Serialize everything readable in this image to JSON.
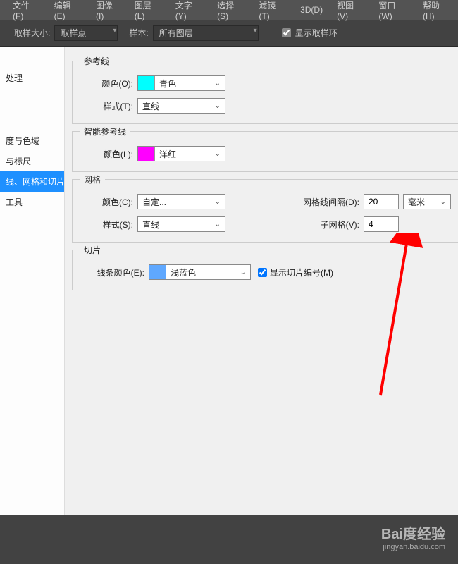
{
  "menubar": [
    {
      "label": "文件(F)"
    },
    {
      "label": "编辑(E)"
    },
    {
      "label": "图像(I)"
    },
    {
      "label": "图层(L)"
    },
    {
      "label": "文字(Y)"
    },
    {
      "label": "选择(S)"
    },
    {
      "label": "滤镜(T)"
    },
    {
      "label": "3D(D)"
    },
    {
      "label": "视图(V)"
    },
    {
      "label": "窗口(W)"
    },
    {
      "label": "帮助(H)"
    }
  ],
  "toolbar": {
    "sample_size_label": "取样大小:",
    "sample_size_value": "取样点",
    "sample_label": "样本:",
    "sample_value": "所有图层",
    "show_ring_label": "显示取样环",
    "show_ring_checked": true
  },
  "sidebar": {
    "items": [
      {
        "label": "处理",
        "selected": false
      },
      {
        "label": "度与色域",
        "selected": false
      },
      {
        "label": "与标尺",
        "selected": false
      },
      {
        "label": "线、网格和切片",
        "selected": true
      },
      {
        "label": "工具",
        "selected": false
      }
    ]
  },
  "guides": {
    "title": "参考线",
    "color_label": "颜色(O):",
    "color_value": "青色",
    "color_swatch": "#00ffff",
    "style_label": "样式(T):",
    "style_value": "直线"
  },
  "smart_guides": {
    "title": "智能参考线",
    "color_label": "颜色(L):",
    "color_value": "洋红",
    "color_swatch": "#ff00ff"
  },
  "grid": {
    "title": "网格",
    "color_label": "颜色(C):",
    "color_value": "自定...",
    "style_label": "样式(S):",
    "style_value": "直线",
    "gridline_label": "网格线间隔(D):",
    "gridline_value": "20",
    "gridline_unit": "毫米",
    "subdiv_label": "子网格(V):",
    "subdiv_value": "4"
  },
  "slice": {
    "title": "切片",
    "color_label": "线条颜色(E):",
    "color_value": "浅蓝色",
    "color_swatch": "#5fa8ff",
    "show_numbers_label": "显示切片编号(M)",
    "show_numbers_checked": true
  },
  "watermark": {
    "logo": "Bai度经验",
    "url": "jingyan.baidu.com"
  },
  "annotation": {
    "arrow_color": "#ff0000"
  }
}
